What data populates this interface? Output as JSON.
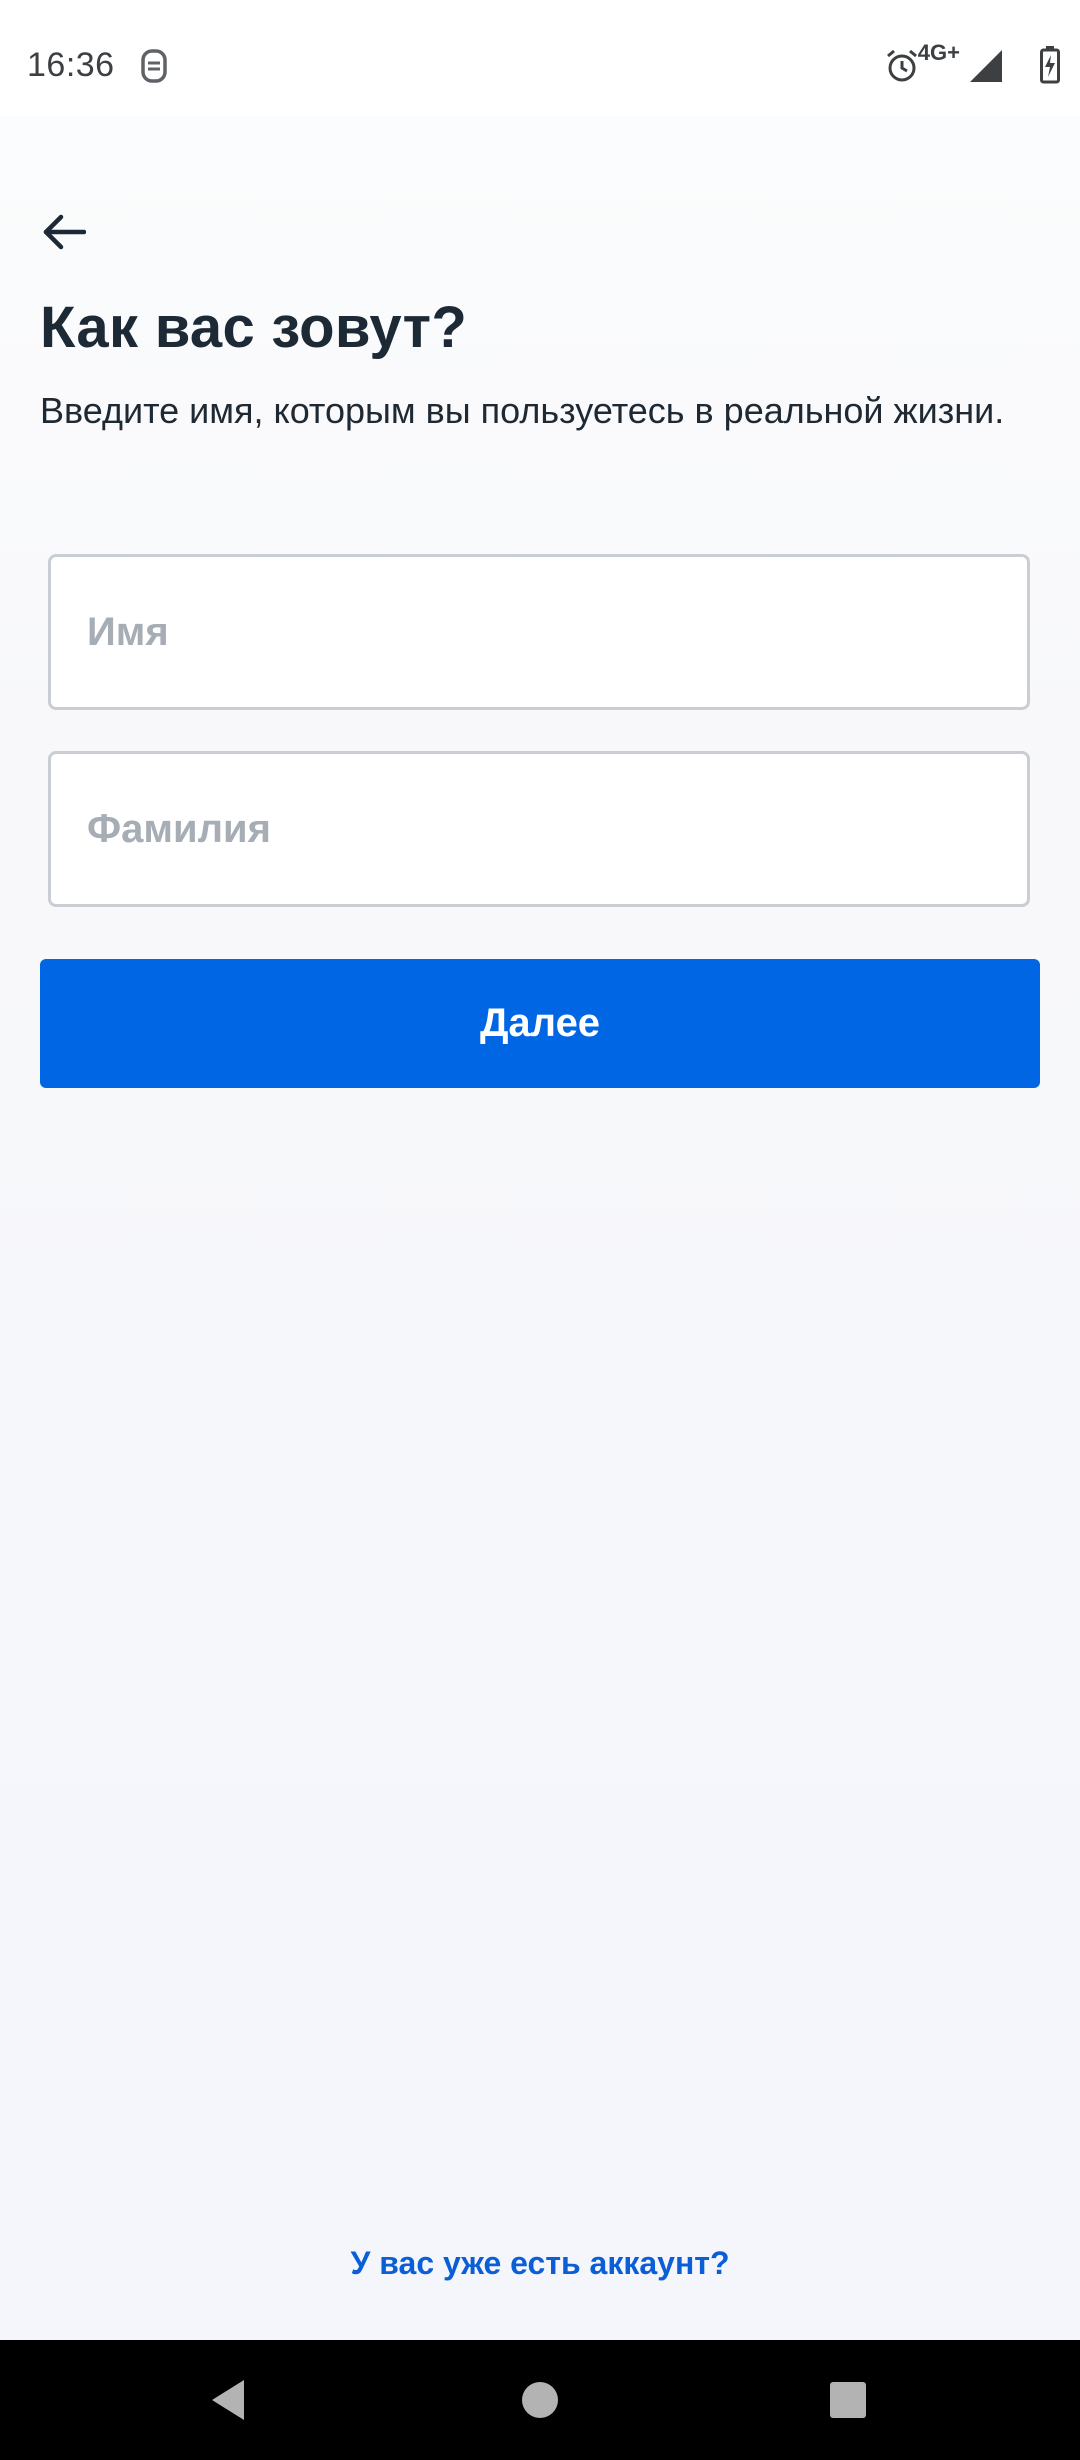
{
  "status_bar": {
    "time": "16:36",
    "network": "4G+"
  },
  "screen": {
    "title": "Как вас зовут?",
    "subtitle": "Введите имя, которым вы пользуетесь в реальной жизни."
  },
  "form": {
    "first_name": {
      "value": "",
      "placeholder": "Имя"
    },
    "last_name": {
      "value": "",
      "placeholder": "Фамилия"
    },
    "next_label": "Далее"
  },
  "footer": {
    "account_link": "У вас уже есть аккаунт?"
  },
  "colors": {
    "primary": "#0066e4",
    "link": "#0a5fd6",
    "title": "#1d2a36"
  },
  "icons": {
    "back": "arrow-left",
    "nav_back": "triangle-left",
    "nav_home": "circle",
    "nav_recents": "square"
  }
}
